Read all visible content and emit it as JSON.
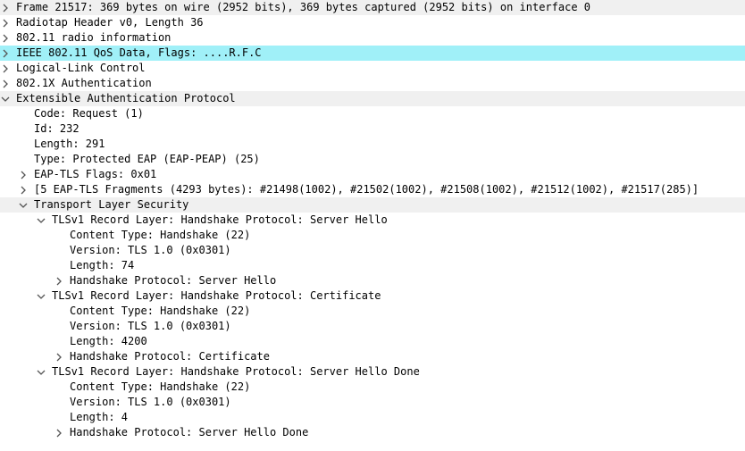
{
  "tree": [
    {
      "label": "Frame 21517: 369 bytes on wire (2952 bits), 369 bytes captured (2952 bits) on interface 0",
      "depth": 0,
      "state": "collapsed",
      "bg": "gray",
      "icon": "chevron-right-icon"
    },
    {
      "label": "Radiotap Header v0, Length 36",
      "depth": 0,
      "state": "collapsed",
      "bg": "white",
      "icon": "chevron-right-icon"
    },
    {
      "label": "802.11 radio information",
      "depth": 0,
      "state": "collapsed",
      "bg": "white",
      "icon": "chevron-right-icon"
    },
    {
      "label": "IEEE 802.11 QoS Data, Flags: ....R.F.C",
      "depth": 0,
      "state": "collapsed",
      "bg": "selected",
      "icon": "chevron-right-icon"
    },
    {
      "label": "Logical-Link Control",
      "depth": 0,
      "state": "collapsed",
      "bg": "white",
      "icon": "chevron-right-icon"
    },
    {
      "label": "802.1X Authentication",
      "depth": 0,
      "state": "collapsed",
      "bg": "white",
      "icon": "chevron-right-icon"
    },
    {
      "label": "Extensible Authentication Protocol",
      "depth": 0,
      "state": "expanded",
      "bg": "gray",
      "icon": "chevron-down-icon"
    },
    {
      "label": "Code: Request (1)",
      "depth": 1,
      "state": "leaf",
      "bg": "white"
    },
    {
      "label": "Id: 232",
      "depth": 1,
      "state": "leaf",
      "bg": "white"
    },
    {
      "label": "Length: 291",
      "depth": 1,
      "state": "leaf",
      "bg": "white"
    },
    {
      "label": "Type: Protected EAP (EAP-PEAP) (25)",
      "depth": 1,
      "state": "leaf",
      "bg": "white"
    },
    {
      "label": "EAP-TLS Flags: 0x01",
      "depth": 1,
      "state": "collapsed",
      "bg": "white",
      "icon": "chevron-right-icon"
    },
    {
      "label": "[5 EAP-TLS Fragments (4293 bytes): #21498(1002), #21502(1002), #21508(1002), #21512(1002), #21517(285)]",
      "depth": 1,
      "state": "collapsed",
      "bg": "white",
      "icon": "chevron-right-icon"
    },
    {
      "label": "Transport Layer Security",
      "depth": 1,
      "state": "expanded",
      "bg": "gray",
      "icon": "chevron-down-icon"
    },
    {
      "label": "TLSv1 Record Layer: Handshake Protocol: Server Hello",
      "depth": 2,
      "state": "expanded",
      "bg": "white",
      "icon": "chevron-down-icon"
    },
    {
      "label": "Content Type: Handshake (22)",
      "depth": 3,
      "state": "leaf",
      "bg": "white"
    },
    {
      "label": "Version: TLS 1.0 (0x0301)",
      "depth": 3,
      "state": "leaf",
      "bg": "white"
    },
    {
      "label": "Length: 74",
      "depth": 3,
      "state": "leaf",
      "bg": "white"
    },
    {
      "label": "Handshake Protocol: Server Hello",
      "depth": 3,
      "state": "collapsed",
      "bg": "white",
      "icon": "chevron-right-icon"
    },
    {
      "label": "TLSv1 Record Layer: Handshake Protocol: Certificate",
      "depth": 2,
      "state": "expanded",
      "bg": "white",
      "icon": "chevron-down-icon"
    },
    {
      "label": "Content Type: Handshake (22)",
      "depth": 3,
      "state": "leaf",
      "bg": "white"
    },
    {
      "label": "Version: TLS 1.0 (0x0301)",
      "depth": 3,
      "state": "leaf",
      "bg": "white"
    },
    {
      "label": "Length: 4200",
      "depth": 3,
      "state": "leaf",
      "bg": "white"
    },
    {
      "label": "Handshake Protocol: Certificate",
      "depth": 3,
      "state": "collapsed",
      "bg": "white",
      "icon": "chevron-right-icon"
    },
    {
      "label": "TLSv1 Record Layer: Handshake Protocol: Server Hello Done",
      "depth": 2,
      "state": "expanded",
      "bg": "white",
      "icon": "chevron-down-icon"
    },
    {
      "label": "Content Type: Handshake (22)",
      "depth": 3,
      "state": "leaf",
      "bg": "white"
    },
    {
      "label": "Version: TLS 1.0 (0x0301)",
      "depth": 3,
      "state": "leaf",
      "bg": "white"
    },
    {
      "label": "Length: 4",
      "depth": 3,
      "state": "leaf",
      "bg": "white"
    },
    {
      "label": "Handshake Protocol: Server Hello Done",
      "depth": 3,
      "state": "collapsed",
      "bg": "white",
      "icon": "chevron-right-icon"
    }
  ]
}
